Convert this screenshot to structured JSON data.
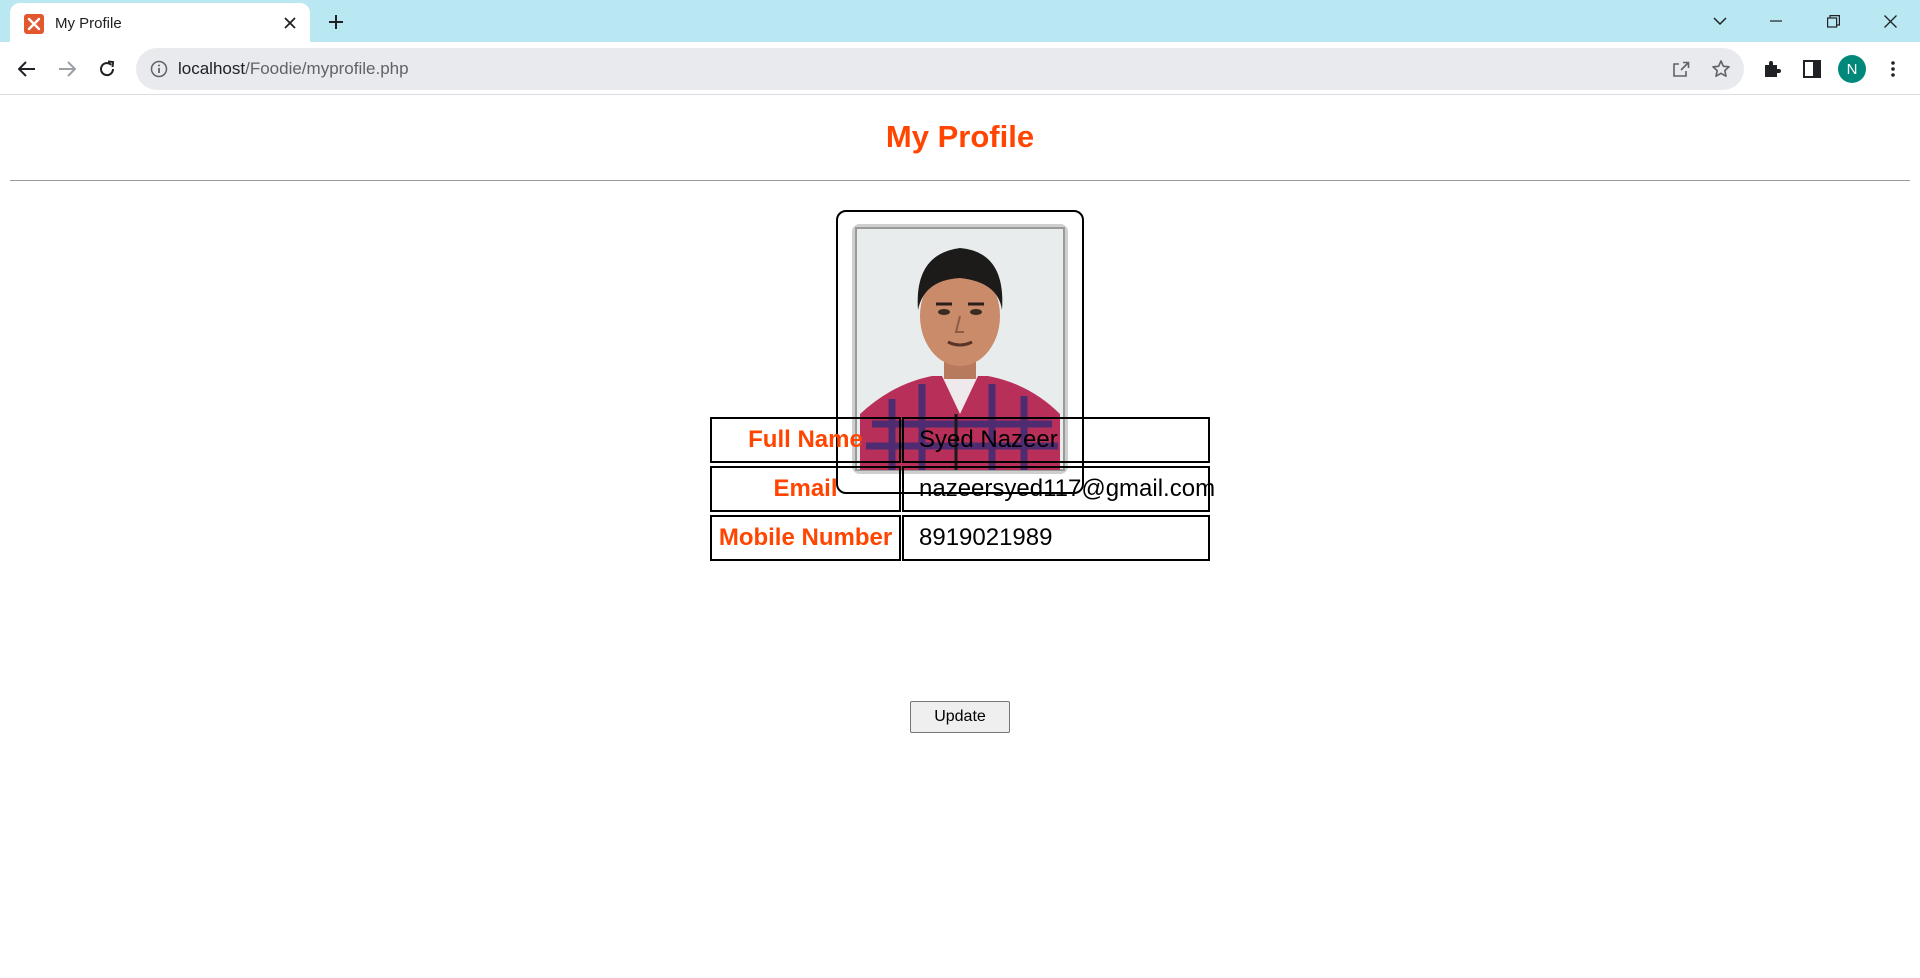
{
  "browser": {
    "tab_title": "My Profile",
    "url_host": "localhost",
    "url_path": "/Foodie/myprofile.php",
    "profile_initial": "N"
  },
  "page": {
    "title": "My Profile",
    "fields": [
      {
        "label": "Full Name",
        "value": "Syed Nazeer"
      },
      {
        "label": "Email",
        "value": "nazeersyed117@gmail.com"
      },
      {
        "label": "Mobile Number",
        "value": "8919021989"
      }
    ],
    "update_label": "Update"
  },
  "colors": {
    "accent": "#ff4500",
    "tabstrip": "#b9e8f3",
    "avatar": "#00897b"
  }
}
